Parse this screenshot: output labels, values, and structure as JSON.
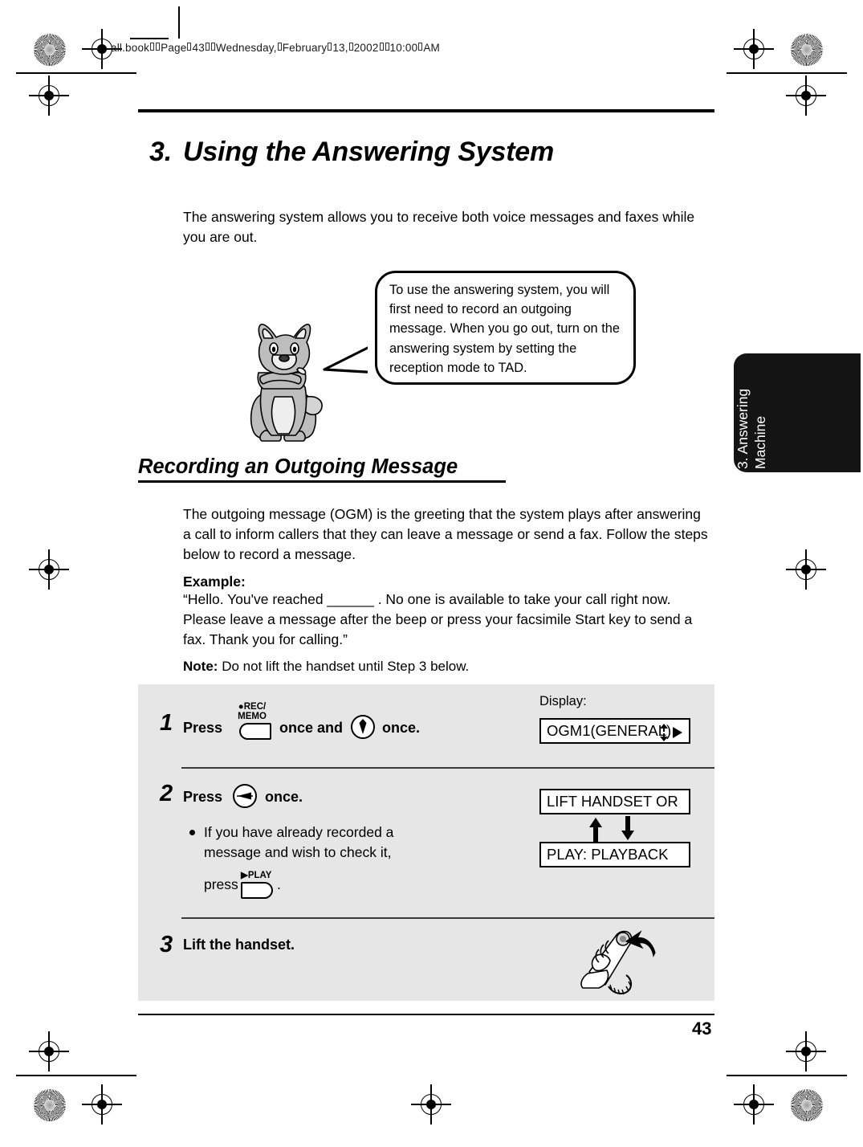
{
  "header": {
    "slug_parts": [
      "all.book",
      "Page",
      "43",
      "Wednesday,",
      "February",
      "13,",
      "2002",
      "10:00",
      "AM"
    ],
    "slug_text": "all.book  Page 43  Wednesday,  February 13,  2002  10:00 AM"
  },
  "chapter": {
    "number": "3.",
    "title": "Using the Answering System"
  },
  "intro": "The answering system allows you to receive both voice messages and faxes while you are out.",
  "balloon": {
    "text": "To use the answering system, you will first need to record an outgoing message. When you go out, turn on the answering system by setting the reception mode to TAD."
  },
  "section": {
    "heading": "Recording an Outgoing Message",
    "body": "The outgoing message (OGM) is the greeting that the system plays after answering a call to inform callers that they can leave a message or send a fax. Follow the steps below to record a message.",
    "example_label": "Example:",
    "example_body": "“Hello. You've reached ______ . No one is available to take your call right now. Please leave a message after the beep or press your facsimile Start key to send a fax. Thank you for calling.”",
    "note_label": "Note:",
    "note_body": "Do not lift the handset until Step 3 below."
  },
  "side_tab": {
    "label": "3. Answering\nMachine"
  },
  "steps": [
    {
      "number": "1",
      "press_word": "Press",
      "key1_line1": "●REC/",
      "key1_line2": "MEMO",
      "mid_text": "once and",
      "key2_icon": "down-arrow-circle-key",
      "end_text": "once.",
      "display_label": "Display:",
      "display_value": "OGM1(GENERAL)"
    },
    {
      "number": "2",
      "press_word": "Press",
      "key1_icon": "right-arrow-circle-key",
      "end_text": "once.",
      "bullet_line1": "If you have already recorded a",
      "bullet_line2": "message and wish to check it,",
      "bullet_line3_pre": "press",
      "bullet_key_label": "▶PLAY",
      "bullet_line3_post": ".",
      "display_value_1": "LIFT HANDSET OR",
      "display_value_2": "PLAY: PLAYBACK"
    },
    {
      "number": "3",
      "text": "Lift the handset.",
      "illustration": "hand-lifting-handset"
    }
  ],
  "footer": {
    "page_number": "43"
  },
  "colors": {
    "panel_gray": "#e6e6e6",
    "tab_black": "#141414",
    "mascot_gray": "#bdbdbd",
    "mascot_light": "#eeeeee"
  }
}
